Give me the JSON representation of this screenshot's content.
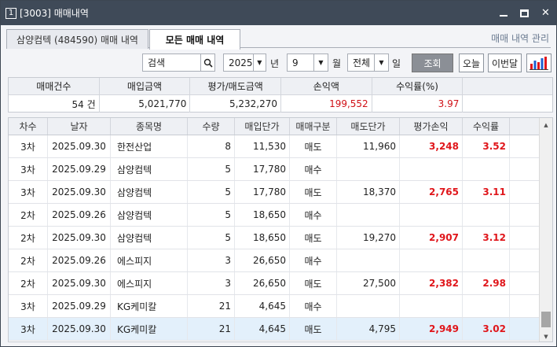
{
  "window": {
    "number": "1",
    "title": "[3003] 매매내역",
    "min_icon": "minimize-icon",
    "max_icon": "maximize-icon",
    "close_icon": "close-icon",
    "close_glyph": "✕"
  },
  "tabs": [
    {
      "label": "삼양컴텍 (484590) 매매 내역",
      "active": false
    },
    {
      "label": "모든 매매 내역",
      "active": true
    }
  ],
  "manage_link": "매매 내역 관리",
  "filter": {
    "search_placeholder": "검색",
    "search_icon": "search-icon",
    "year": "2025",
    "year_label": "년",
    "month": "9",
    "month_label": "월",
    "day": "전체",
    "day_label": "일",
    "query_btn": "조회",
    "today_btn": "오늘",
    "this_month_btn": "이번달",
    "chart_icon": "bar-chart-icon"
  },
  "summary": {
    "headers": [
      "매매건수",
      "매입금액",
      "평가/매도금액",
      "손익액",
      "수익률(%)",
      ""
    ],
    "values": [
      "54 건",
      "5,021,770",
      "5,232,270",
      "199,552",
      "3.97",
      ""
    ]
  },
  "grid": {
    "headers": [
      "차수",
      "날자",
      "종목명",
      "수량",
      "매입단가",
      "매매구분",
      "매도단가",
      "평가손익",
      "수익률"
    ],
    "rows": [
      [
        "3차",
        "2025.09.30",
        "한전산업",
        "8",
        "11,530",
        "매도",
        "11,960",
        "3,248",
        "3.52"
      ],
      [
        "3차",
        "2025.09.29",
        "삼양컴텍",
        "5",
        "17,780",
        "매수",
        "",
        "",
        ""
      ],
      [
        "3차",
        "2025.09.30",
        "삼양컴텍",
        "5",
        "17,780",
        "매도",
        "18,370",
        "2,765",
        "3.11"
      ],
      [
        "2차",
        "2025.09.26",
        "삼양컴텍",
        "5",
        "18,650",
        "매수",
        "",
        "",
        ""
      ],
      [
        "2차",
        "2025.09.30",
        "삼양컴텍",
        "5",
        "18,650",
        "매도",
        "19,270",
        "2,907",
        "3.12"
      ],
      [
        "2차",
        "2025.09.26",
        "에스피지",
        "3",
        "26,650",
        "매수",
        "",
        "",
        ""
      ],
      [
        "2차",
        "2025.09.30",
        "에스피지",
        "3",
        "26,650",
        "매도",
        "27,500",
        "2,382",
        "2.98"
      ],
      [
        "3차",
        "2025.09.29",
        "KG케미칼",
        "21",
        "4,645",
        "매수",
        "",
        "",
        ""
      ],
      [
        "3차",
        "2025.09.30",
        "KG케미칼",
        "21",
        "4,645",
        "매도",
        "4,795",
        "2,949",
        "3.02"
      ]
    ],
    "selected_row": 8
  },
  "colors": {
    "titlebar": "#3f4a58",
    "profit": "#e0161b",
    "selected": "#e3f0fb"
  }
}
